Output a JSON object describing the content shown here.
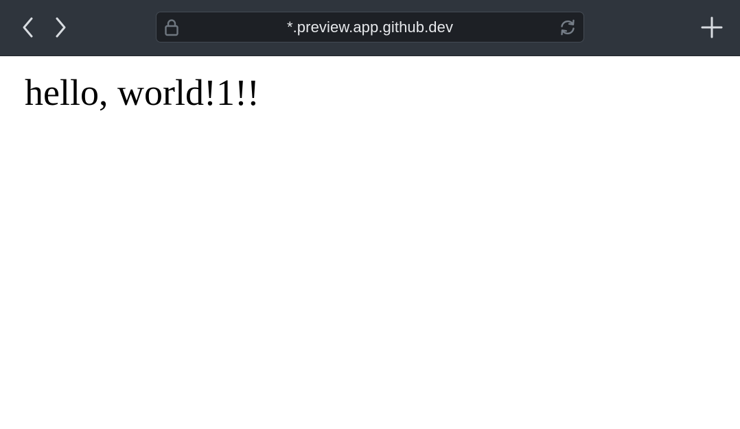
{
  "toolbar": {
    "background_color": "#2f353d",
    "back_icon": "chevron-left-icon",
    "forward_icon": "chevron-right-icon",
    "new_tab_icon": "plus-icon"
  },
  "address_bar": {
    "url": "*.preview.app.github.dev",
    "lock_icon": "lock-icon",
    "reload_icon": "reload-icon",
    "background_color": "#1d2025"
  },
  "page": {
    "heading": "hello, world!1!!"
  }
}
